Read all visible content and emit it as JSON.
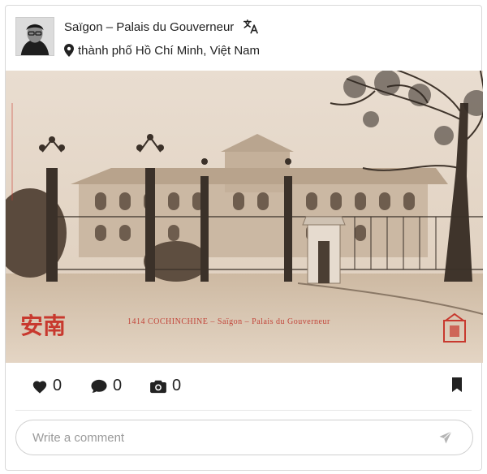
{
  "post": {
    "title": "Saïgon – Palais du Gouverneur",
    "location": "thành phố Hồ Chí Minh, Việt Nam"
  },
  "photo": {
    "caption": "1414   COCHINCHINE – Saïgon – Palais du Gouverneur",
    "stamp_text": "安南"
  },
  "actions": {
    "likes": "0",
    "comments": "0",
    "photos": "0"
  },
  "comment": {
    "placeholder": "Write a comment"
  },
  "icons": {
    "translate": "translate-icon",
    "location": "map-pin-icon",
    "like": "heart-icon",
    "comment": "speech-bubble-icon",
    "photo": "camera-icon",
    "bookmark": "bookmark-icon",
    "send": "paper-plane-icon"
  }
}
